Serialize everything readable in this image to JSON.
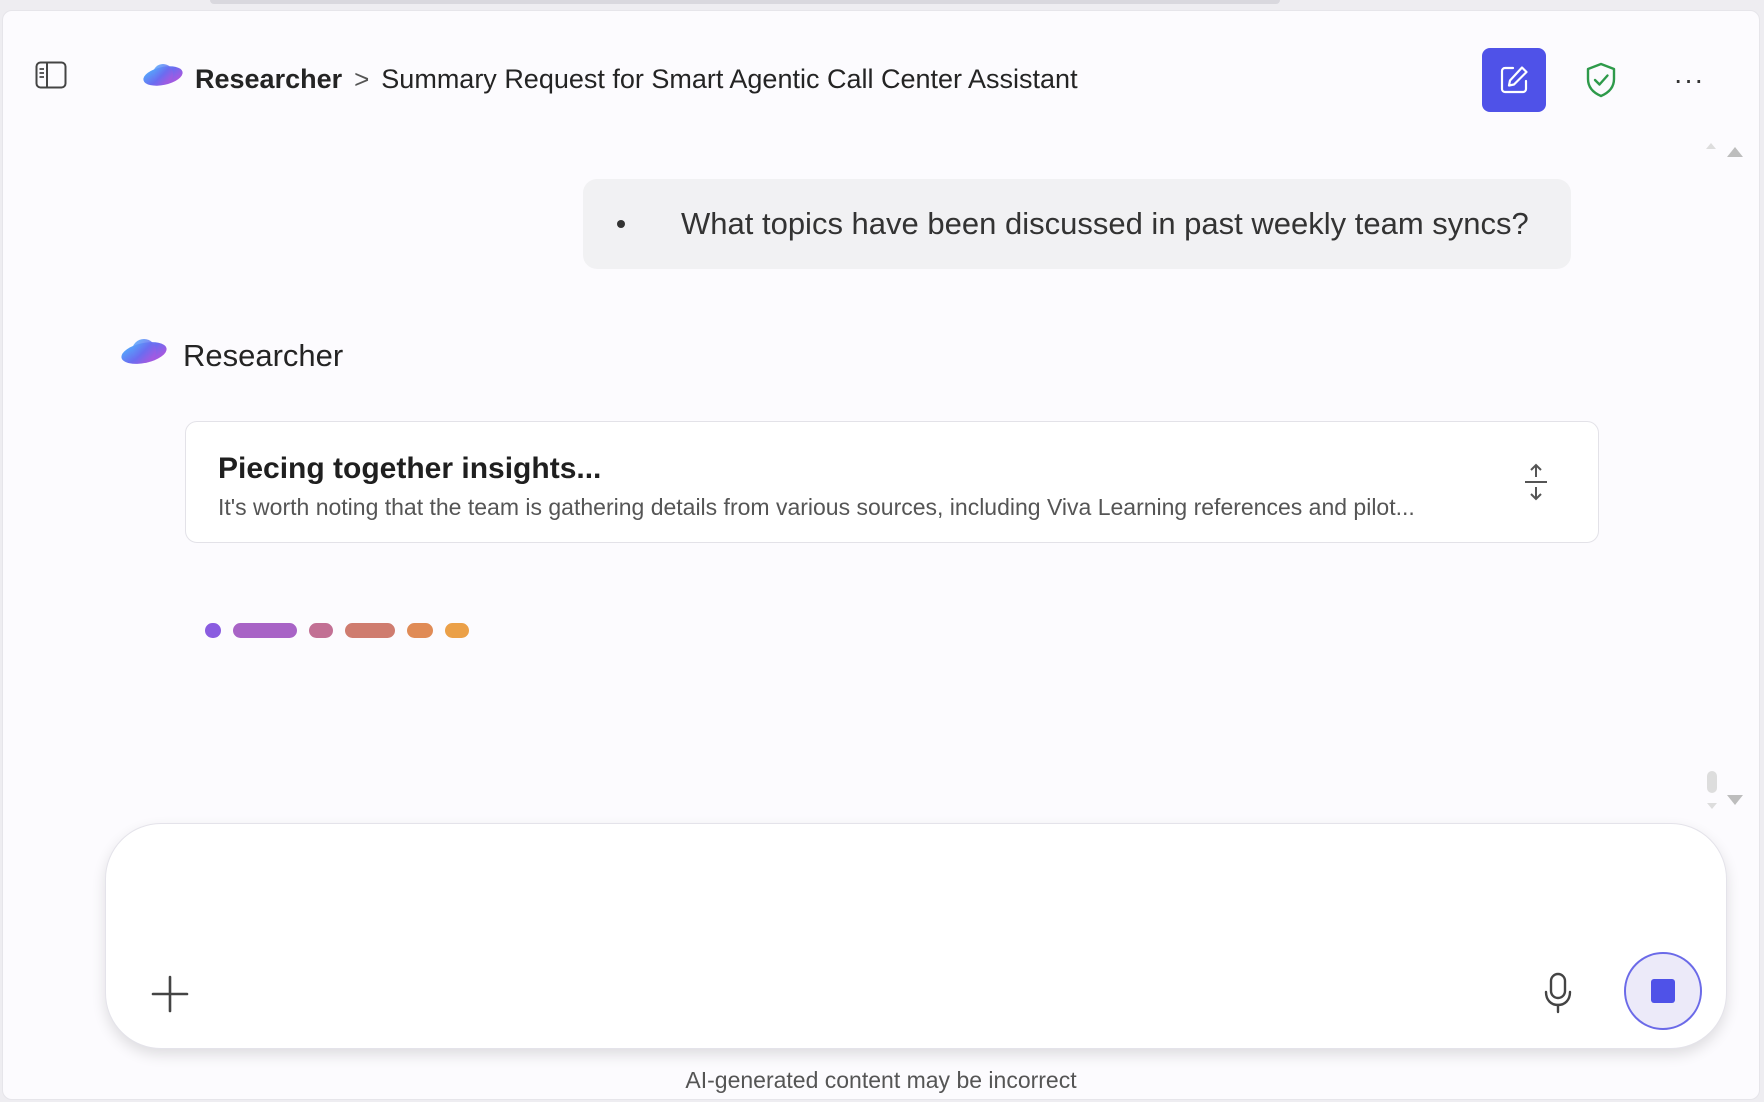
{
  "header": {
    "app_name": "Researcher",
    "separator": ">",
    "conversation_title": "Summary Request for Smart Agentic Call Center Assistant",
    "more_label": "···"
  },
  "conversation": {
    "user_message": "What topics have been discussed in past weekly team syncs?",
    "assistant_name": "Researcher",
    "status_card": {
      "title": "Piecing together insights...",
      "detail": "It's worth noting that the team is gathering details from various sources, including Viva Learning references and pilot..."
    }
  },
  "composer": {
    "placeholder": "",
    "disclaimer": "AI-generated content may be incorrect"
  },
  "icons": {
    "sidebar_toggle": "sidebar-toggle-icon",
    "logo": "researcher-logo-icon",
    "new_chat": "edit-icon",
    "shield": "shield-check-icon",
    "more": "more-icon",
    "expand": "expand-vertical-icon",
    "add": "plus-icon",
    "mic": "microphone-icon",
    "stop": "stop-icon"
  },
  "colors": {
    "accent": "#4f52e8",
    "shield": "#2e9a4a",
    "loading_gradient": [
      "#8a5ce0",
      "#a863c6",
      "#c27094",
      "#cf7c6f",
      "#e08b56",
      "#eba048"
    ]
  }
}
